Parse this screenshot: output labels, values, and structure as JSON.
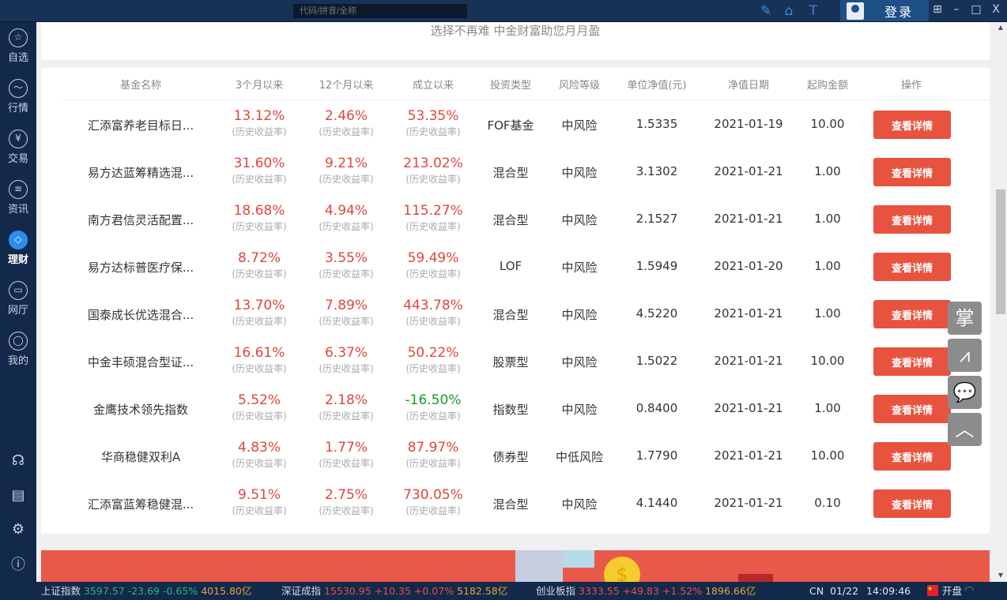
{
  "topbar": {
    "search_placeholder": "代码/拼音/全称",
    "login_label": "登录",
    "icons": [
      "edit-icon",
      "home-icon",
      "font-size-icon"
    ],
    "window_controls": [
      "restore-icon",
      "minimize-icon",
      "maximize-icon",
      "close-icon"
    ]
  },
  "sidebar": {
    "items": [
      {
        "label": "自选",
        "icon": "star-icon"
      },
      {
        "label": "行情",
        "icon": "trend-icon"
      },
      {
        "label": "交易",
        "icon": "yen-icon"
      },
      {
        "label": "资讯",
        "icon": "news-icon"
      },
      {
        "label": "理财",
        "icon": "diamond-icon",
        "active": true
      },
      {
        "label": "网厅",
        "icon": "briefcase-icon"
      },
      {
        "label": "我的",
        "icon": "user-icon"
      }
    ],
    "bottom_icons": [
      "headset-icon",
      "inbox-icon",
      "settings-icon",
      "info-icon"
    ]
  },
  "slogan": "选择不再难 中金财富助您月月盈",
  "table": {
    "headers": [
      "基金名称",
      "3个月以来",
      "12个月以来",
      "成立以来",
      "投资类型",
      "风险等级",
      "单位净值(元)",
      "净值日期",
      "起购金额",
      "操作"
    ],
    "sub_label": "(历史收益率)",
    "button_label": "查看详情",
    "rows": [
      {
        "name": "汇添富养老目标日...",
        "m3": "13.12%",
        "m12": "2.46%",
        "since": "53.35%",
        "type": "FOF基金",
        "risk": "中风险",
        "nav": "1.5335",
        "date": "2021-01-19",
        "min": "10.00"
      },
      {
        "name": "易方达蓝筹精选混...",
        "m3": "31.60%",
        "m12": "9.21%",
        "since": "213.02%",
        "type": "混合型",
        "risk": "中风险",
        "nav": "3.1302",
        "date": "2021-01-21",
        "min": "1.00"
      },
      {
        "name": "南方君信灵活配置...",
        "m3": "18.68%",
        "m12": "4.94%",
        "since": "115.27%",
        "type": "混合型",
        "risk": "中风险",
        "nav": "2.1527",
        "date": "2021-01-21",
        "min": "1.00"
      },
      {
        "name": "易方达标普医疗保...",
        "m3": "8.72%",
        "m12": "3.55%",
        "since": "59.49%",
        "type": "LOF",
        "risk": "中风险",
        "nav": "1.5949",
        "date": "2021-01-20",
        "min": "1.00"
      },
      {
        "name": "国泰成长优选混合...",
        "m3": "13.70%",
        "m12": "7.89%",
        "since": "443.78%",
        "type": "混合型",
        "risk": "中风险",
        "nav": "4.5220",
        "date": "2021-01-21",
        "min": "1.00"
      },
      {
        "name": "中金丰硕混合型证...",
        "m3": "16.61%",
        "m12": "6.37%",
        "since": "50.22%",
        "type": "股票型",
        "risk": "中风险",
        "nav": "1.5022",
        "date": "2021-01-21",
        "min": "10.00"
      },
      {
        "name": "金鹰技术领先指数",
        "m3": "5.52%",
        "m12": "2.18%",
        "since": "-16.50%",
        "type": "指数型",
        "risk": "中风险",
        "nav": "0.8400",
        "date": "2021-01-21",
        "min": "1.00"
      },
      {
        "name": "华商稳健双利A",
        "m3": "4.83%",
        "m12": "1.77%",
        "since": "87.97%",
        "type": "债券型",
        "risk": "中低风险",
        "nav": "1.7790",
        "date": "2021-01-21",
        "min": "10.00"
      },
      {
        "name": "汇添富蓝筹稳健混...",
        "m3": "9.51%",
        "m12": "2.75%",
        "since": "730.05%",
        "type": "混合型",
        "risk": "中风险",
        "nav": "4.1440",
        "date": "2021-01-21",
        "min": "0.10"
      }
    ]
  },
  "float_buttons": [
    {
      "label": "掌",
      "icon": "mobile-icon"
    },
    {
      "icon": "presentation-icon"
    },
    {
      "icon": "wechat-icon"
    },
    {
      "icon": "back-to-top-icon"
    }
  ],
  "statusbar": {
    "indices": [
      {
        "name": "上证指数",
        "value": "3597.57",
        "change": "-23.69",
        "pct": "-0.65%",
        "amount": "4015.80亿",
        "up": false
      },
      {
        "name": "深证成指",
        "value": "15530.95",
        "change": "+10.35",
        "pct": "+0.07%",
        "amount": "5182.58亿",
        "up": true
      },
      {
        "name": "创业板指",
        "value": "3333.55",
        "change": "+49.83",
        "pct": "+1.52%",
        "amount": "1896.66亿",
        "up": true
      }
    ],
    "lang": "CN",
    "date": "01/22",
    "time": "14:09:46",
    "market_status": "开盘"
  },
  "colors": {
    "accent_red": "#e8533f",
    "up": "#ee4b4b",
    "down": "#2bb673",
    "sidebar": "#13294b",
    "active": "#2a8ef0"
  }
}
